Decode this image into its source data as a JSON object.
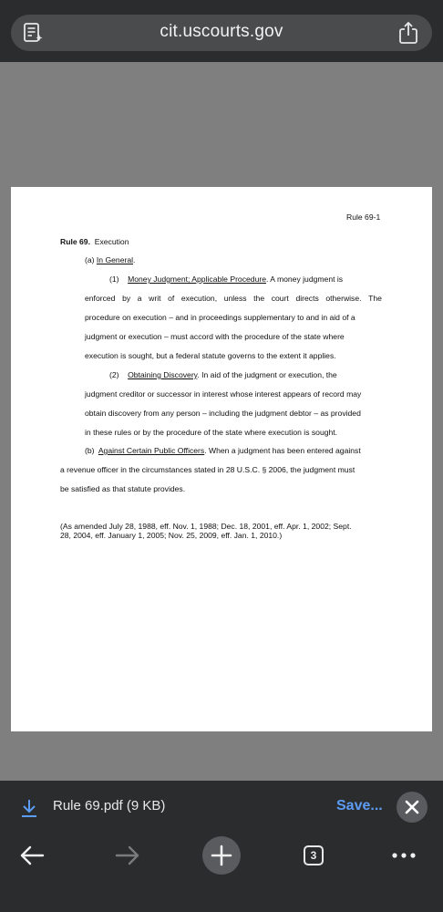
{
  "address_bar": {
    "url": "cit.uscourts.gov"
  },
  "document": {
    "header_right": "Rule 69-1",
    "rule_label": "Rule 69.",
    "rule_title": "Execution",
    "a_prefix": "(a)",
    "a_title": "In General",
    "p1_num": "(1)",
    "p1_title": "Money Judgment; Applicable Procedure",
    "p1_line1_tail": ".  A money judgment is",
    "p1_line2_words": [
      "enforced",
      "by",
      "a",
      "writ",
      "of",
      "execution,",
      "unless",
      "the",
      "court",
      "directs",
      "otherwise.",
      "The"
    ],
    "p1_line3": "procedure on execution – and in proceedings supplementary to and in aid of a",
    "p1_line4": "judgment or execution – must accord with the procedure of the state where",
    "p1_line5": "execution is sought, but a federal statute governs to the extent it applies.",
    "p2_num": "(2)",
    "p2_title": "Obtaining Discovery",
    "p2_line1_tail": ".  In aid of the judgment or execution, the",
    "p2_line2": "judgment creditor or successor in interest whose interest appears of record may",
    "p2_line3": "obtain discovery from any person – including the judgment debtor – as provided",
    "p2_line4": "in these rules or by the procedure of the state where execution is sought.",
    "b_prefix": "(b)",
    "b_title": "Against Certain Public Officers",
    "b_line1_tail": ".  When a judgment has been entered against",
    "b_line2": "a revenue officer in the circumstances stated in 28 U.S.C. § 2006, the judgment must",
    "b_line3": "be satisfied as that statute provides.",
    "amend_line1": "(As amended July 28, 1988, eff. Nov. 1, 1988; Dec. 18, 2001, eff. Apr. 1, 2002; Sept.",
    "amend_line2": "28, 2004, eff. January 1, 2005; Nov. 25, 2009, eff. Jan. 1, 2010.)"
  },
  "download_bar": {
    "file_label": "Rule 69.pdf (9 KB)",
    "save_label": "Save..."
  },
  "toolbar": {
    "tab_count": "3"
  },
  "icons": {
    "reader": "reader-mode-icon",
    "share": "share-icon",
    "download": "download-arrow-icon",
    "close": "close-icon",
    "back": "back-arrow-icon",
    "forward": "forward-arrow-icon",
    "new_tab": "plus-icon",
    "tabs": "tab-switcher-icon",
    "more": "more-icon"
  },
  "colors": {
    "chrome_bg": "#2b2c2e",
    "viewer_bg": "#7f7f7f",
    "accent": "#5c9cf5"
  }
}
